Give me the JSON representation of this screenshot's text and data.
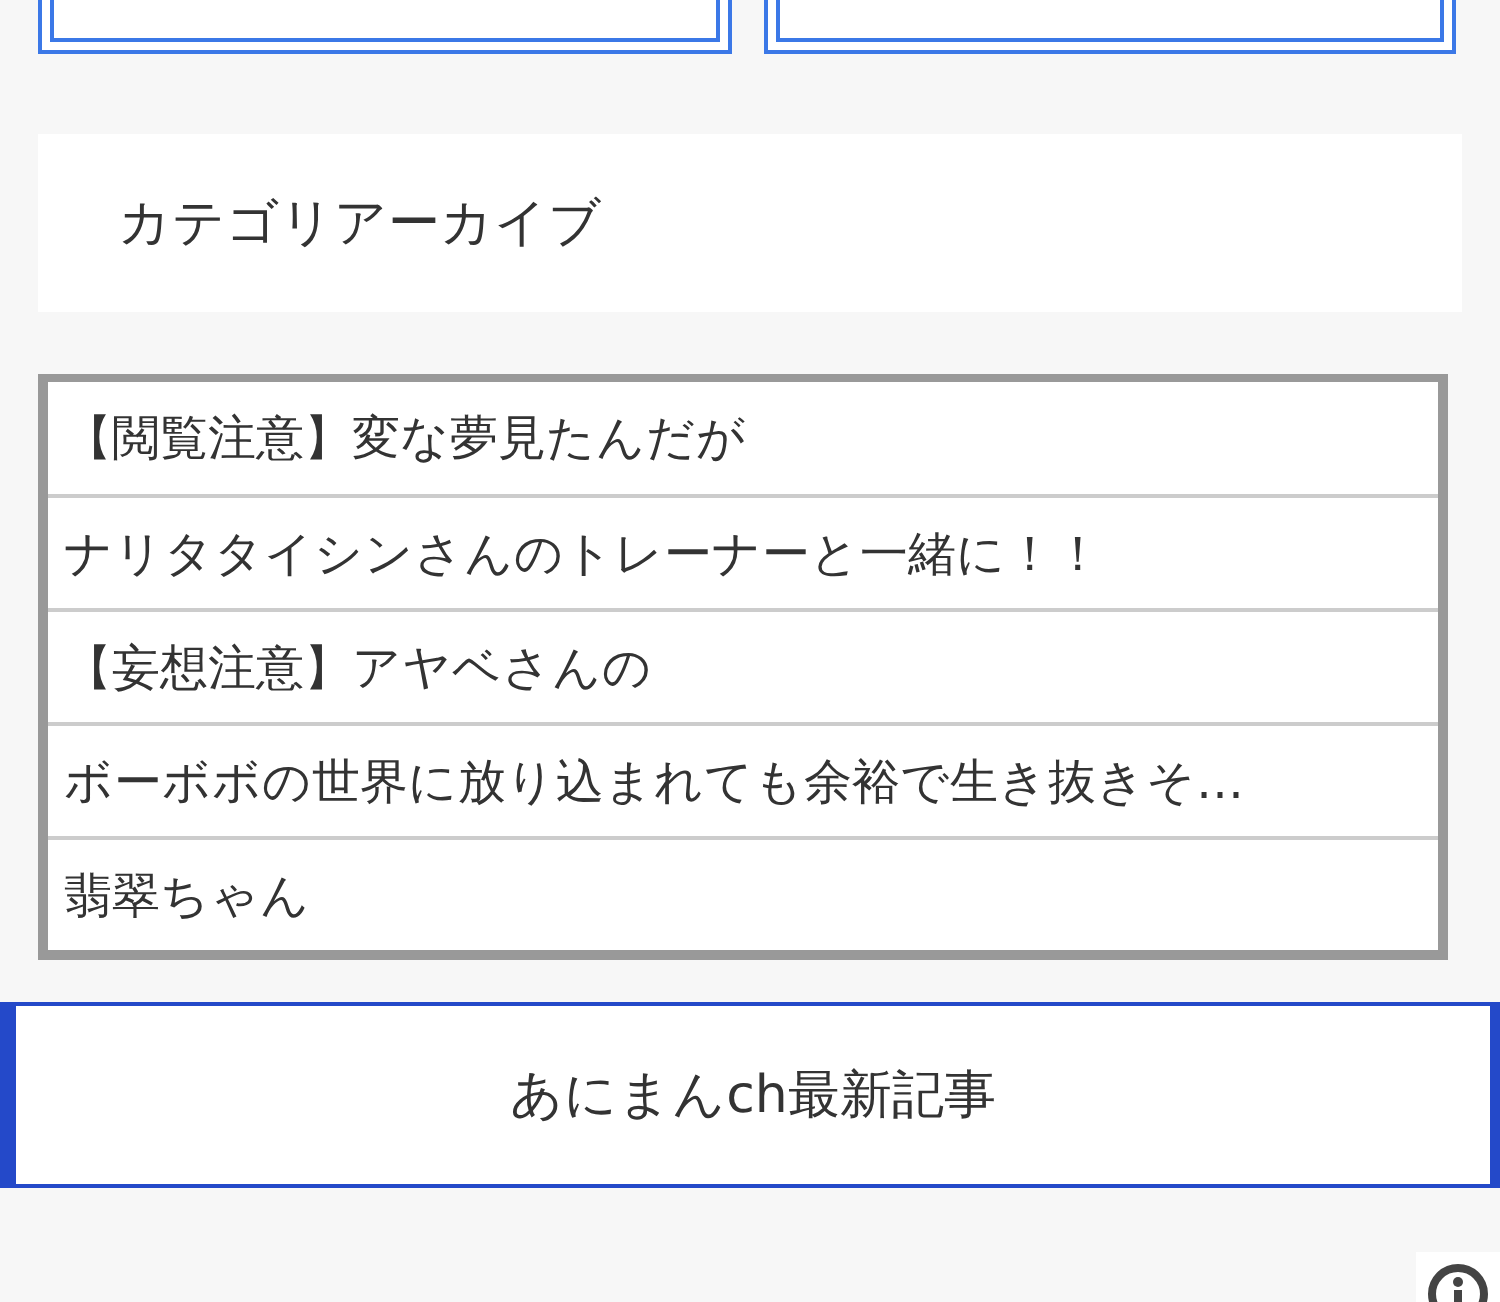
{
  "top_buttons": [
    {
      "kind": "button"
    },
    {
      "kind": "button"
    }
  ],
  "category_archive": {
    "title": "カテゴリアーカイブ"
  },
  "articles": [
    "【閲覧注意】変な夢見たんだが",
    "ナリタタイシンさんのトレーナーと一緒に！！",
    "【妄想注意】アヤベさんの",
    "ボーボボの世界に放り込まれても余裕で生き抜きそ…",
    "翡翠ちゃん"
  ],
  "latest_section": {
    "title": "あにまんch最新記事"
  }
}
